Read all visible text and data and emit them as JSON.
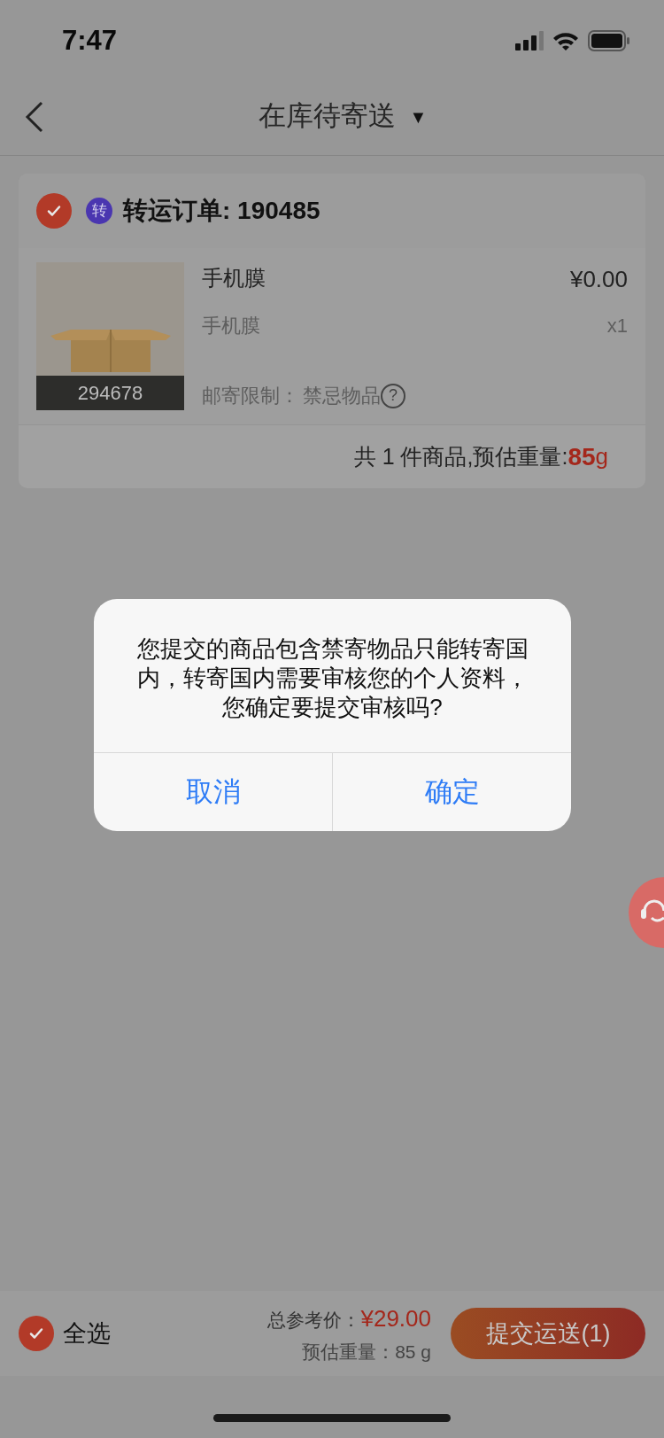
{
  "status_bar": {
    "time": "7:47"
  },
  "nav": {
    "title": "在库待寄送",
    "dropdown_glyph": "▼"
  },
  "order": {
    "checked": true,
    "badge": "转",
    "title": "转运订单: 190485",
    "item": {
      "name": "手机膜",
      "price": "¥0.00",
      "spec": "手机膜",
      "quantity": "x1",
      "code": "294678",
      "restriction_label": "邮寄限制：",
      "restriction_value": "禁忌物品",
      "help_glyph": "?"
    },
    "summary": "共 1 件商品,预估重量:",
    "weight_value": "85",
    "weight_unit": "g"
  },
  "dialog": {
    "message": "您提交的商品包含禁寄物品只能转寄国内，转寄国内需要审核您的个人资料，您确定要提交审核吗?",
    "buttons": [
      "取消",
      "确定"
    ]
  },
  "bottom_bar": {
    "select_all_checked": true,
    "select_all_label": "全选",
    "total_label": "总参考价：",
    "total_value": "¥29.00",
    "weight": "预估重量：85 g",
    "submit": "提交运送(1)"
  }
}
